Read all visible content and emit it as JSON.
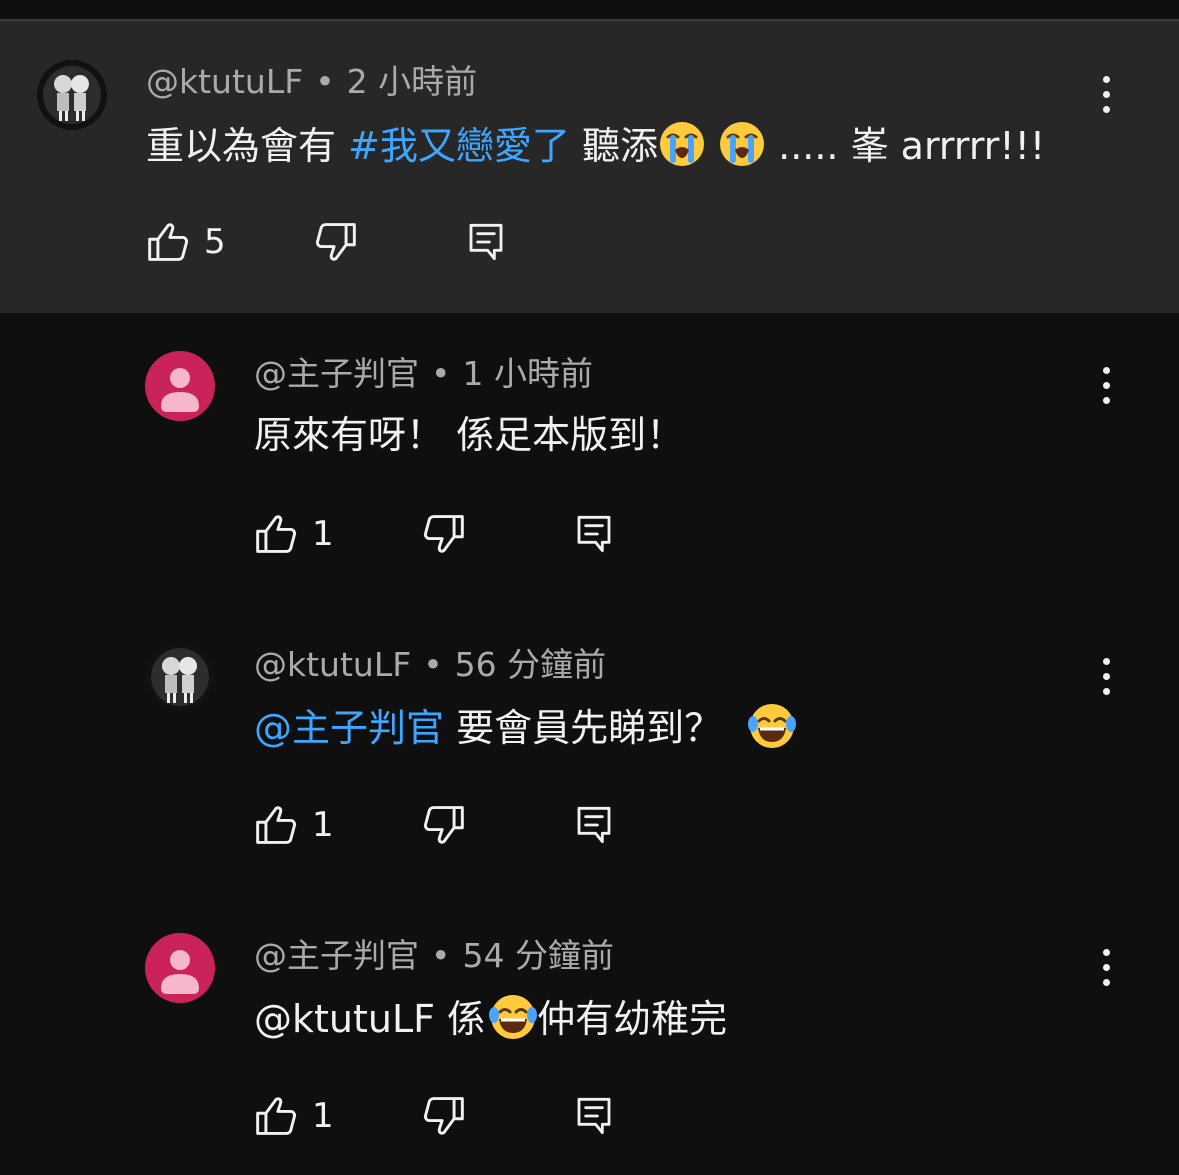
{
  "comments": [
    {
      "author": "@ktutuLF",
      "time": "2 小時前",
      "text_a": "重以為會有 ",
      "hashtag": "#我又戀愛了",
      "text_b": " 聽添",
      "text_c": " ..... 峯 arrrrr!!!",
      "emoji": "loudly-crying-face",
      "likes": "5",
      "highlighted": true
    },
    {
      "author": "@主子判官",
      "time": "1 小時前",
      "text": "原來有呀！ 係足本版到！",
      "likes": "1",
      "avatar_color": "#c9235a"
    },
    {
      "author": "@ktutuLF",
      "time": "56 分鐘前",
      "mention": "@主子判官",
      "text": " 要會員先睇到？ ",
      "emoji": "face-with-tears-of-joy",
      "likes": "1"
    },
    {
      "author": "@主子判官",
      "time": "54 分鐘前",
      "text_a": "@ktutuLF 係",
      "text_b": "仲有幼稚完",
      "emoji": "face-with-tears-of-joy",
      "likes": "1",
      "avatar_color": "#c9235a"
    }
  ],
  "separator": "•",
  "colors": {
    "background": "#0f0f0f",
    "highlight_background": "#272727",
    "link": "#3ea6ff",
    "meta_text": "#aaaaaa",
    "primary_text": "#f1f1f1",
    "avatar_pink": "#c9235a"
  }
}
